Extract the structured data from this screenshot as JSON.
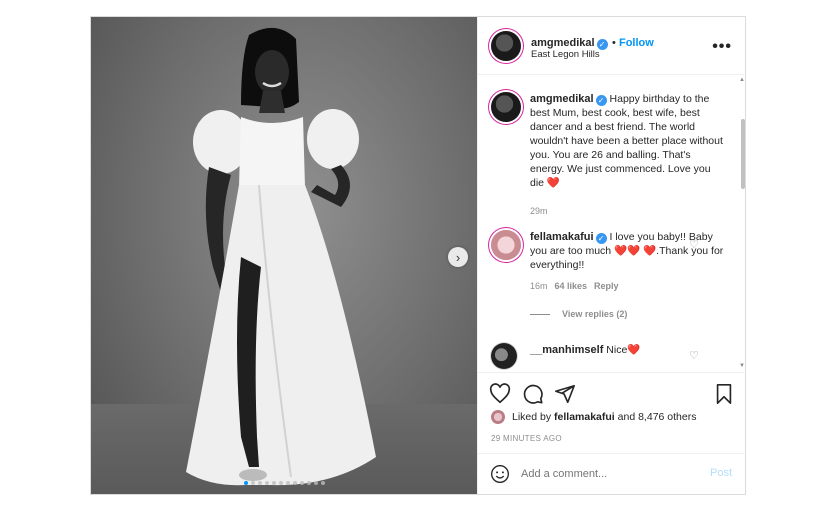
{
  "header": {
    "username": "amgmedikal",
    "follow_label": "Follow",
    "location": "East Legon Hills",
    "more_label": "•••"
  },
  "caption": {
    "username": "amgmedikal",
    "text": "Happy birthday to the best Mum, best cook, best wife, best dancer and a best friend. The world wouldn't have been a better place without you. You are 26 and balling. That's energy. We just commenced. Love you die ❤️",
    "time": "29m"
  },
  "comments": [
    {
      "username": "fellamakafui",
      "verified": true,
      "text": "I love you baby!! Baby you are too much ❤️❤️ ❤️.Thank you for everything!!",
      "time": "16m",
      "likes": "64 likes",
      "reply_label": "Reply",
      "view_replies": "View replies (2)"
    },
    {
      "username": "__manhimself",
      "verified": false,
      "text": "Nice❤️"
    }
  ],
  "likes": {
    "prefix": "Liked by",
    "user": "fellamakafui",
    "suffix": "and 8,476 others"
  },
  "time_ago": "29 MINUTES AGO",
  "add_comment": {
    "placeholder": "Add a comment...",
    "post_label": "Post"
  },
  "carousel": {
    "total": 12,
    "current": 1
  },
  "colors": {
    "accent": "#0095f6",
    "heart": "#c8102e",
    "verified": "#3897f0",
    "story_ring": "#d6249f"
  },
  "icons": [
    "heart-icon",
    "comment-icon",
    "share-icon",
    "bookmark-icon",
    "emoji-icon",
    "more-icon",
    "verified-icon",
    "chevron-right-icon"
  ]
}
